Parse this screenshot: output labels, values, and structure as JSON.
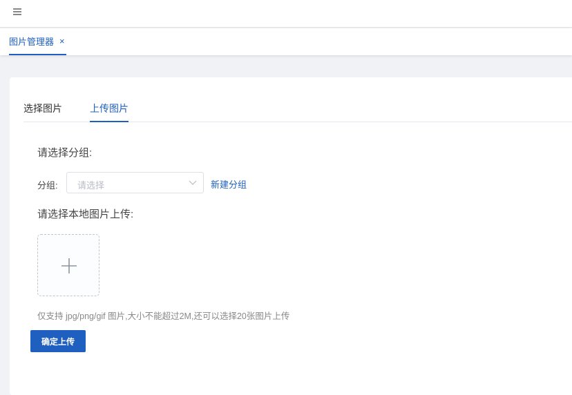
{
  "header": {
    "menu_icon": "hamburger-menu-icon"
  },
  "page_tabs": {
    "active_label": "图片管理器",
    "close_glyph": "×"
  },
  "tabs": [
    {
      "label": "选择图片",
      "active": false
    },
    {
      "label": "上传图片",
      "active": true
    }
  ],
  "form": {
    "group_heading": "请选择分组:",
    "group_label": "分组:",
    "group_placeholder": "请选择",
    "new_group_link": "新建分组",
    "upload_heading": "请选择本地图片上传:",
    "upload_hint": "仅支持 jpg/png/gif 图片,大小不能超过2M,还可以选择20张图片上传",
    "submit_label": "确定上传"
  },
  "colors": {
    "accent": "#1f5fbf",
    "background": "#f0f2f5"
  }
}
